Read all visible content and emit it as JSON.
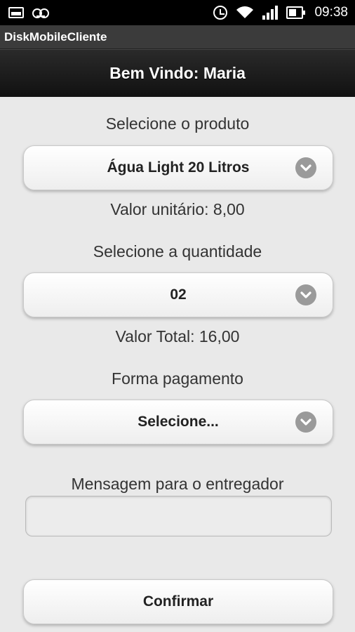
{
  "status_bar": {
    "time": "09:38",
    "icons": [
      "image-icon",
      "voicemail-icon",
      "alarm-icon",
      "wifi-icon",
      "signal-icon",
      "battery-icon"
    ]
  },
  "app_title": "DiskMobileCliente",
  "header": {
    "title": "Bem Vindo: Maria"
  },
  "product": {
    "label": "Selecione o produto",
    "selected": "Água Light 20 Litros",
    "unit_price_text": "Valor unitário: 8,00"
  },
  "quantity": {
    "label": "Selecione a quantidade",
    "selected": "02",
    "total_text": "Valor Total: 16,00"
  },
  "payment": {
    "label": "Forma pagamento",
    "selected": "Selecione..."
  },
  "message": {
    "label": "Mensagem para o entregador",
    "value": ""
  },
  "confirm_label": "Confirmar",
  "colors": {
    "background": "#e9e9e9",
    "header_bg": "#1a1a1a",
    "chevron": "#9a9a9a"
  }
}
